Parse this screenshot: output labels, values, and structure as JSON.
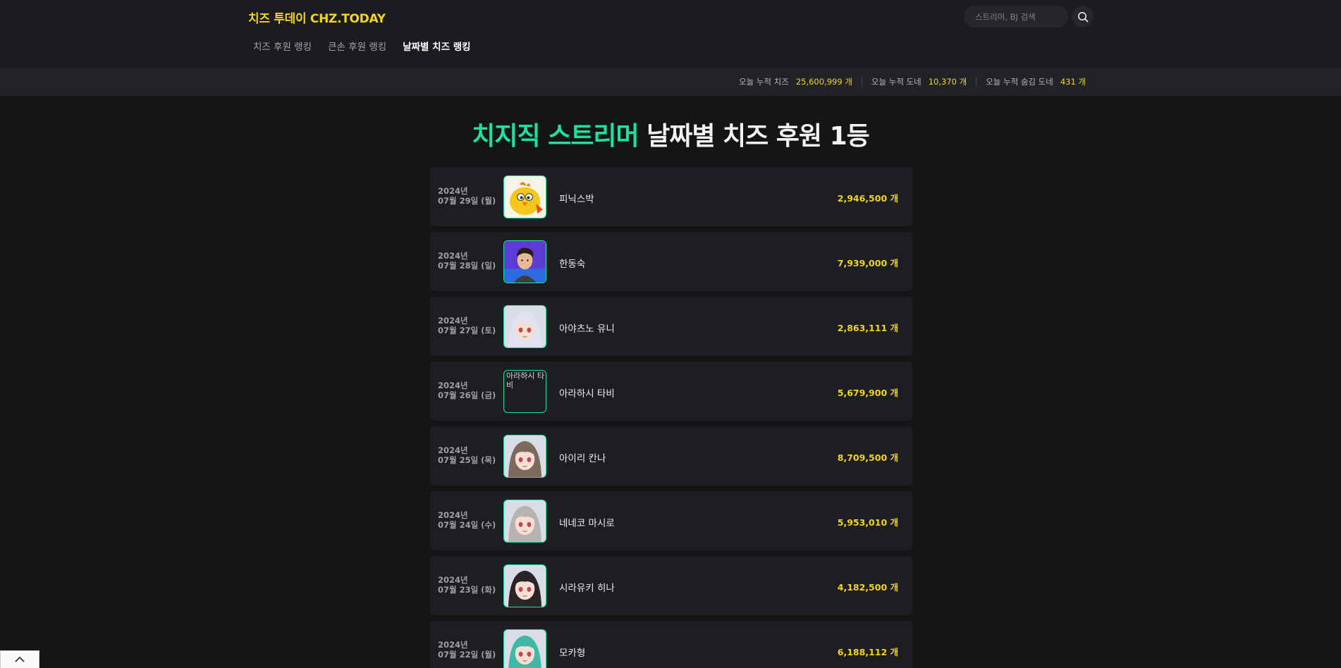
{
  "header": {
    "logo": "치즈 투데이 CHZ.TODAY",
    "nav": [
      {
        "label": "치즈 후원 랭킹",
        "active": false
      },
      {
        "label": "큰손 후원 랭킹",
        "active": false
      },
      {
        "label": "날짜별 치즈 랭킹",
        "active": true
      }
    ],
    "search": {
      "placeholder": "스트리머, BJ 검색",
      "value": ""
    }
  },
  "stats": [
    {
      "label": "오늘 누적 치즈",
      "value": "25,600,999 개"
    },
    {
      "label": "오늘 누적 도네",
      "value": "10,370 개"
    },
    {
      "label": "오늘 누적 숨김 도네",
      "value": "431 개"
    }
  ],
  "page": {
    "title_accent": "치지직 스트리머",
    "title_rest": " 날짜별 치즈 후원 1등"
  },
  "rankings": [
    {
      "year": "2024년",
      "date": "07월 29일 (월)",
      "name": "피닉스박",
      "amount": "2,946,500 개",
      "avatar": "yellow-bird-icon",
      "avatar_color": "#f5c71a"
    },
    {
      "year": "2024년",
      "date": "07월 28일 (일)",
      "name": "한동숙",
      "amount": "7,939,000 개",
      "avatar": "man-portrait-icon",
      "avatar_color": "#5d3bd6"
    },
    {
      "year": "2024년",
      "date": "07월 27일 (토)",
      "name": "아야츠노 유니",
      "amount": "2,863,111 개",
      "avatar": "white-hair-character-icon",
      "avatar_color": "#dfe3ef"
    },
    {
      "year": "2024년",
      "date": "07월 26일 (금)",
      "name": "아라하시 타비",
      "amount": "5,679,900 개",
      "avatar": "broken-image-icon",
      "avatar_alt": "아라하시 타비"
    },
    {
      "year": "2024년",
      "date": "07월 25일 (목)",
      "name": "아이리 칸나",
      "amount": "8,709,500 개",
      "avatar": "brown-hair-character-icon",
      "avatar_color": "#7d6a5c"
    },
    {
      "year": "2024년",
      "date": "07월 24일 (수)",
      "name": "네네코 마시로",
      "amount": "5,953,010 개",
      "avatar": "grey-hair-character-icon",
      "avatar_color": "#b8b2b0"
    },
    {
      "year": "2024년",
      "date": "07월 23일 (화)",
      "name": "시라유키 히나",
      "amount": "4,182,500 개",
      "avatar": "black-hair-character-icon",
      "avatar_color": "#2b2426"
    },
    {
      "year": "2024년",
      "date": "07월 22일 (월)",
      "name": "모카형",
      "amount": "6,188,112 개",
      "avatar": "teal-hair-character-icon",
      "avatar_color": "#3fb8a6"
    }
  ]
}
